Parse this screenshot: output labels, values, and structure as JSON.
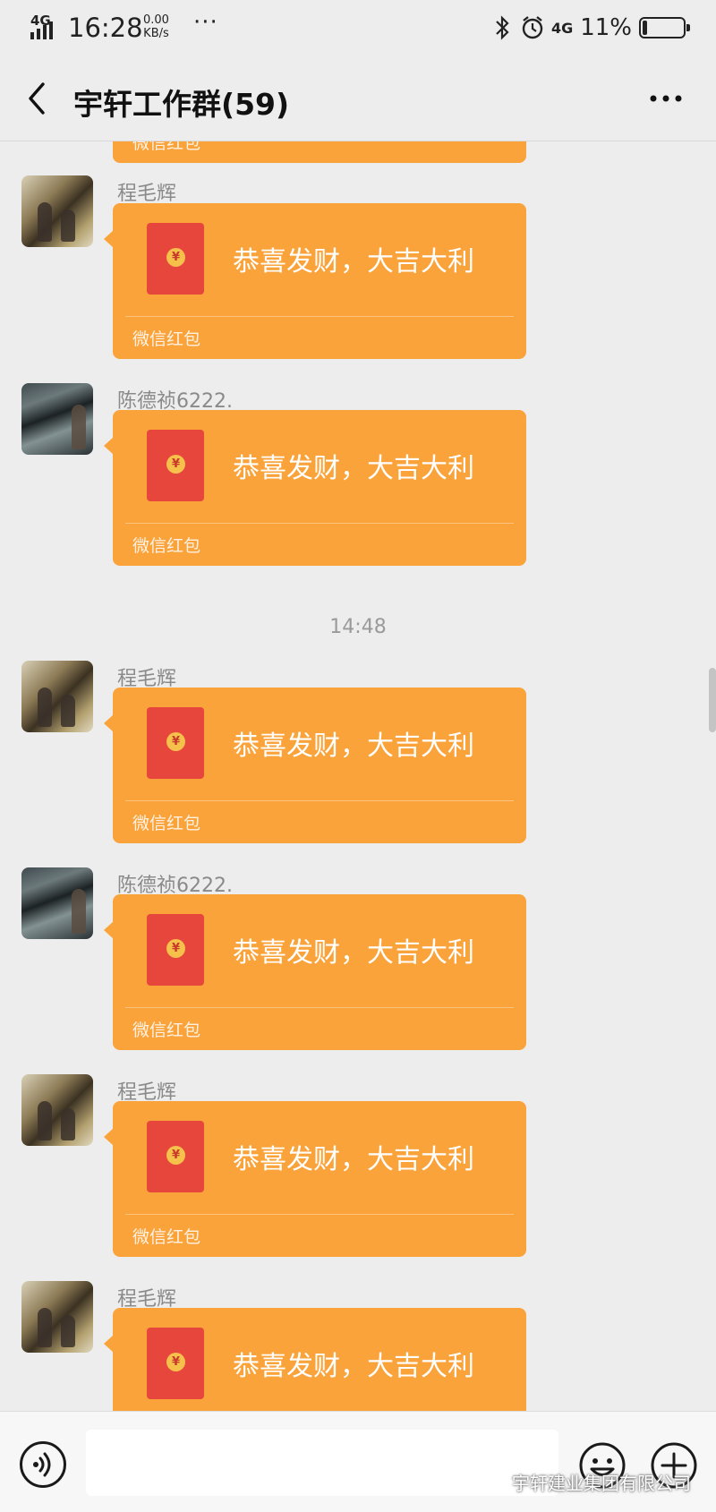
{
  "status_bar": {
    "network": "4G",
    "time": "16:28",
    "speed_value": "0.00",
    "speed_unit": "KB/s",
    "more": "···",
    "network_right": "4G",
    "battery_percent": "11%",
    "battery_level": 0.11
  },
  "header": {
    "title": "宇轩工作群(59)"
  },
  "chat": {
    "top_partial_label": "微信红包",
    "timestamp": "14:48",
    "messages": [
      {
        "sender": "程毛辉",
        "greeting": "恭喜发财，大吉大利",
        "label": "微信红包"
      },
      {
        "sender": "陈德祯6222.",
        "greeting": "恭喜发财，大吉大利",
        "label": "微信红包"
      },
      {
        "sender": "程毛辉",
        "greeting": "恭喜发财，大吉大利",
        "label": "微信红包"
      },
      {
        "sender": "陈德祯6222.",
        "greeting": "恭喜发财，大吉大利",
        "label": "微信红包"
      },
      {
        "sender": "程毛辉",
        "greeting": "恭喜发财，大吉大利",
        "label": "微信红包"
      },
      {
        "sender": "程毛辉",
        "greeting": "恭喜发财，大吉大利",
        "label": ""
      }
    ],
    "coin_symbol": "¥"
  },
  "input_bar": {
    "input_value": ""
  },
  "watermark": {
    "text": "宇轩建业集团有限公司"
  },
  "colors": {
    "bubble": "#f9a33a",
    "envelope": "#e7463d",
    "coin": "#f6c14a",
    "background": "#ededed"
  }
}
